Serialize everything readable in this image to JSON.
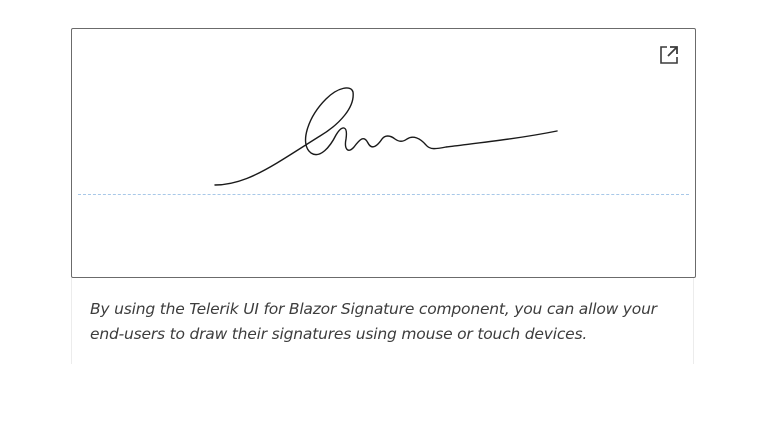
{
  "signature": {
    "stroke_color": "#1a1a1a",
    "baseline_color": "#a8c8e8",
    "maximize_icon": "external-link-icon"
  },
  "description": {
    "line1": "By using the Telerik UI for Blazor Signature component, you can allow your",
    "line2": "end-users to draw their signatures using mouse or touch devices."
  }
}
